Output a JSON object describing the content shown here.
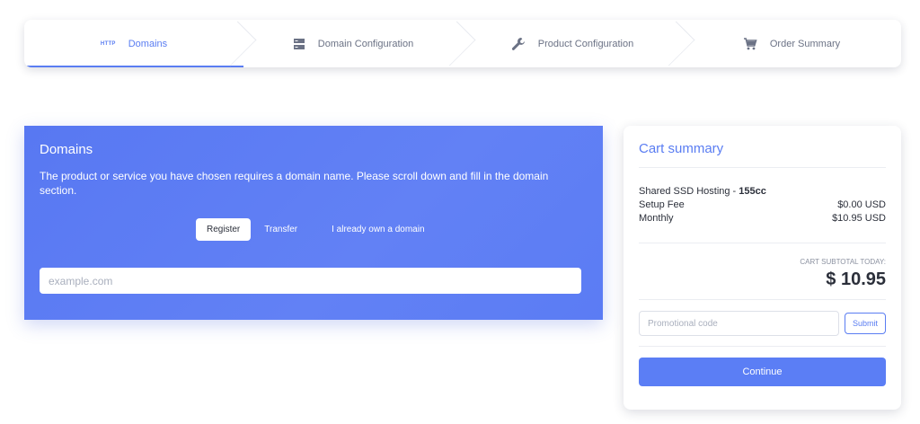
{
  "steps": [
    {
      "badge": "HTTP",
      "label": "Domains",
      "icon": "http-icon",
      "active": true
    },
    {
      "label": "Domain Configuration",
      "icon": "server-icon"
    },
    {
      "label": "Product Configuration",
      "icon": "wrench-icon"
    },
    {
      "label": "Order Summary",
      "icon": "cart-icon"
    }
  ],
  "domains": {
    "title": "Domains",
    "description": "The product or service you have chosen requires a domain name. Please scroll down and fill in the domain section.",
    "tabs": [
      "Register",
      "Transfer",
      "I already own a domain"
    ],
    "active_tab": "Register",
    "input_placeholder": "example.com"
  },
  "cart": {
    "title": "Cart summary",
    "product_name": "Shared SSD Hosting - ",
    "product_plan": "155cc",
    "lines": [
      {
        "label": "Setup Fee",
        "value": "$0.00 USD"
      },
      {
        "label": "Monthly",
        "value": "$10.95 USD"
      }
    ],
    "subtotal_label": "CART SUBTOTAL TODAY:",
    "subtotal_value": "$ 10.95",
    "promo_placeholder": "Promotional code",
    "submit_label": "Submit",
    "continue_label": "Continue"
  },
  "colors": {
    "accent": "#5a7df2",
    "panel": "#5b7cf4"
  }
}
